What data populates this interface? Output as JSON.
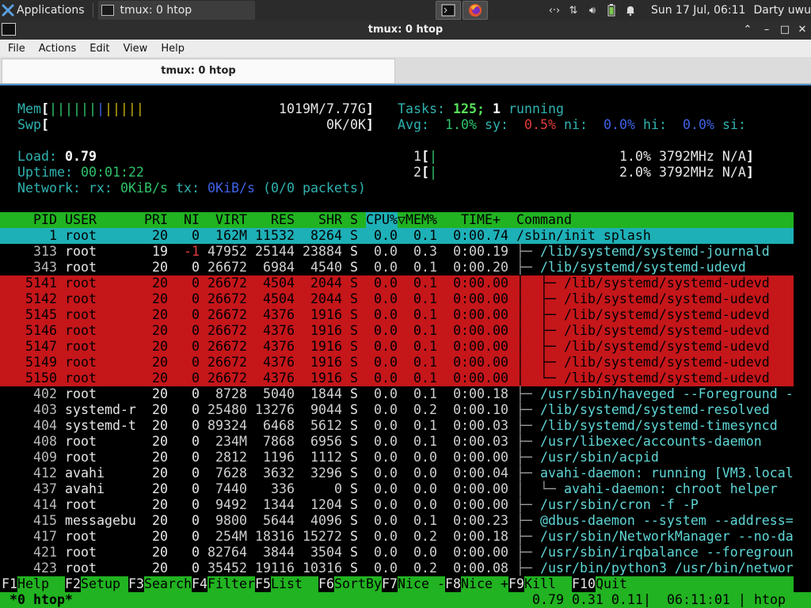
{
  "panel": {
    "apps_label": "Applications",
    "task_label": "tmux: 0 htop",
    "clock": "Sun 17 Jul, 06:11",
    "user": "Darty uwu"
  },
  "window": {
    "title": "tmux: 0 htop",
    "menu": [
      "File",
      "Actions",
      "Edit",
      "View",
      "Help"
    ],
    "tab_label": "tmux: 0 htop"
  },
  "htop": {
    "mem_label": "Mem",
    "mem_bar": "||||||||||||",
    "mem_value": "1019M/7.77G",
    "swp_label": "Swp",
    "swp_value": "0K/0K",
    "tasks_label": "Tasks:",
    "tasks_count": "125;",
    "running_count": "1",
    "running_label": "running",
    "avg_label": "Avg:",
    "avg_us": "1.0%",
    "sy_label": "sy:",
    "avg_sy": "0.5%",
    "ni_label": "ni:",
    "avg_ni": "0.0%",
    "hi_label": "hi:",
    "avg_hi": "0.0%",
    "si_label": "si:",
    "load_label": "Load:",
    "load_value": "0.79",
    "uptime_label": "Uptime:",
    "uptime_value": "00:01:22",
    "network_label": "Network: rx:",
    "rx_value": "0KiB/s",
    "tx_label": "tx:",
    "tx_value": "0KiB/s",
    "packets": "(0/0 packets)",
    "cpu1_label": "1",
    "cpu1_value": "1.0% 3792MHz N/A",
    "cpu2_label": "2",
    "cpu2_value": "2.0% 3792MHz N/A",
    "columns": [
      "PID",
      "USER",
      "PRI",
      "NI",
      "VIRT",
      "RES",
      "SHR",
      "S",
      "CPU%",
      "MEM%",
      "TIME+",
      "Command"
    ],
    "sort_marker": "▽",
    "rows": [
      {
        "pid": "1",
        "user": "root",
        "pri": "20",
        "ni": "0",
        "virt": "162M",
        "res": "11532",
        "shr": "8264",
        "s": "S",
        "cpu": "0.0",
        "mem": "0.1",
        "time": "0:00.74",
        "tree": "",
        "cmd": "/sbin/init splash",
        "style": "selected"
      },
      {
        "pid": "313",
        "user": "root",
        "pri": "19",
        "ni": "-1",
        "virt": "47952",
        "res": "25144",
        "shr": "23884",
        "s": "S",
        "cpu": "0.0",
        "mem": "0.3",
        "time": "0:00.19",
        "tree": "├─ ",
        "cmd": "/lib/systemd/systemd-journald",
        "style": "normal"
      },
      {
        "pid": "343",
        "user": "root",
        "pri": "20",
        "ni": "0",
        "virt": "26672",
        "res": "6984",
        "shr": "4540",
        "s": "S",
        "cpu": "0.0",
        "mem": "0.1",
        "time": "0:00.20",
        "tree": "├─ ",
        "cmd": "/lib/systemd/systemd-udevd",
        "style": "normal"
      },
      {
        "pid": "5141",
        "user": "root",
        "pri": "20",
        "ni": "0",
        "virt": "26672",
        "res": "4504",
        "shr": "2044",
        "s": "S",
        "cpu": "0.0",
        "mem": "0.1",
        "time": "0:00.00",
        "tree": "│  ├─ ",
        "cmd": "/lib/systemd/systemd-udevd",
        "style": "tagged"
      },
      {
        "pid": "5142",
        "user": "root",
        "pri": "20",
        "ni": "0",
        "virt": "26672",
        "res": "4504",
        "shr": "2044",
        "s": "S",
        "cpu": "0.0",
        "mem": "0.1",
        "time": "0:00.00",
        "tree": "│  ├─ ",
        "cmd": "/lib/systemd/systemd-udevd",
        "style": "tagged"
      },
      {
        "pid": "5145",
        "user": "root",
        "pri": "20",
        "ni": "0",
        "virt": "26672",
        "res": "4376",
        "shr": "1916",
        "s": "S",
        "cpu": "0.0",
        "mem": "0.1",
        "time": "0:00.00",
        "tree": "│  ├─ ",
        "cmd": "/lib/systemd/systemd-udevd",
        "style": "tagged"
      },
      {
        "pid": "5146",
        "user": "root",
        "pri": "20",
        "ni": "0",
        "virt": "26672",
        "res": "4376",
        "shr": "1916",
        "s": "S",
        "cpu": "0.0",
        "mem": "0.1",
        "time": "0:00.00",
        "tree": "│  ├─ ",
        "cmd": "/lib/systemd/systemd-udevd",
        "style": "tagged"
      },
      {
        "pid": "5147",
        "user": "root",
        "pri": "20",
        "ni": "0",
        "virt": "26672",
        "res": "4376",
        "shr": "1916",
        "s": "S",
        "cpu": "0.0",
        "mem": "0.1",
        "time": "0:00.00",
        "tree": "│  ├─ ",
        "cmd": "/lib/systemd/systemd-udevd",
        "style": "tagged"
      },
      {
        "pid": "5149",
        "user": "root",
        "pri": "20",
        "ni": "0",
        "virt": "26672",
        "res": "4376",
        "shr": "1916",
        "s": "S",
        "cpu": "0.0",
        "mem": "0.1",
        "time": "0:00.00",
        "tree": "│  ├─ ",
        "cmd": "/lib/systemd/systemd-udevd",
        "style": "tagged"
      },
      {
        "pid": "5150",
        "user": "root",
        "pri": "20",
        "ni": "0",
        "virt": "26672",
        "res": "4376",
        "shr": "1916",
        "s": "S",
        "cpu": "0.0",
        "mem": "0.1",
        "time": "0:00.00",
        "tree": "│  └─ ",
        "cmd": "/lib/systemd/systemd-udevd",
        "style": "tagged"
      },
      {
        "pid": "402",
        "user": "root",
        "pri": "20",
        "ni": "0",
        "virt": "8728",
        "res": "5040",
        "shr": "1844",
        "s": "S",
        "cpu": "0.0",
        "mem": "0.1",
        "time": "0:00.18",
        "tree": "├─ ",
        "cmd": "/usr/sbin/haveged --Foreground -",
        "style": "normal"
      },
      {
        "pid": "403",
        "user": "systemd-r",
        "pri": "20",
        "ni": "0",
        "virt": "25480",
        "res": "13276",
        "shr": "9044",
        "s": "S",
        "cpu": "0.0",
        "mem": "0.2",
        "time": "0:00.10",
        "tree": "├─ ",
        "cmd": "/lib/systemd/systemd-resolved",
        "style": "normal"
      },
      {
        "pid": "404",
        "user": "systemd-t",
        "pri": "20",
        "ni": "0",
        "virt": "89324",
        "res": "6468",
        "shr": "5612",
        "s": "S",
        "cpu": "0.0",
        "mem": "0.1",
        "time": "0:00.03",
        "tree": "├─ ",
        "cmd": "/lib/systemd/systemd-timesyncd",
        "style": "normal"
      },
      {
        "pid": "408",
        "user": "root",
        "pri": "20",
        "ni": "0",
        "virt": "234M",
        "res": "7868",
        "shr": "6956",
        "s": "S",
        "cpu": "0.0",
        "mem": "0.1",
        "time": "0:00.03",
        "tree": "├─ ",
        "cmd": "/usr/libexec/accounts-daemon",
        "style": "normal"
      },
      {
        "pid": "409",
        "user": "root",
        "pri": "20",
        "ni": "0",
        "virt": "2812",
        "res": "1196",
        "shr": "1112",
        "s": "S",
        "cpu": "0.0",
        "mem": "0.0",
        "time": "0:00.00",
        "tree": "├─ ",
        "cmd": "/usr/sbin/acpid",
        "style": "normal"
      },
      {
        "pid": "412",
        "user": "avahi",
        "pri": "20",
        "ni": "0",
        "virt": "7628",
        "res": "3632",
        "shr": "3296",
        "s": "S",
        "cpu": "0.0",
        "mem": "0.0",
        "time": "0:00.04",
        "tree": "├─ ",
        "cmd": "avahi-daemon: running [VM3.local",
        "style": "normal"
      },
      {
        "pid": "437",
        "user": "avahi",
        "pri": "20",
        "ni": "0",
        "virt": "7440",
        "res": "336",
        "shr": "0",
        "s": "S",
        "cpu": "0.0",
        "mem": "0.0",
        "time": "0:00.00",
        "tree": "│  └─ ",
        "cmd": "avahi-daemon: chroot helper",
        "style": "normal"
      },
      {
        "pid": "414",
        "user": "root",
        "pri": "20",
        "ni": "0",
        "virt": "9492",
        "res": "1344",
        "shr": "1204",
        "s": "S",
        "cpu": "0.0",
        "mem": "0.0",
        "time": "0:00.00",
        "tree": "├─ ",
        "cmd": "/usr/sbin/cron -f -P",
        "style": "normal"
      },
      {
        "pid": "415",
        "user": "messagebu",
        "pri": "20",
        "ni": "0",
        "virt": "9800",
        "res": "5644",
        "shr": "4096",
        "s": "S",
        "cpu": "0.0",
        "mem": "0.1",
        "time": "0:00.23",
        "tree": "├─ ",
        "cmd": "@dbus-daemon --system --address=",
        "style": "normal"
      },
      {
        "pid": "417",
        "user": "root",
        "pri": "20",
        "ni": "0",
        "virt": "254M",
        "res": "18316",
        "shr": "15272",
        "s": "S",
        "cpu": "0.0",
        "mem": "0.2",
        "time": "0:00.18",
        "tree": "├─ ",
        "cmd": "/usr/sbin/NetworkManager --no-da",
        "style": "normal"
      },
      {
        "pid": "421",
        "user": "root",
        "pri": "20",
        "ni": "0",
        "virt": "82764",
        "res": "3844",
        "shr": "3504",
        "s": "S",
        "cpu": "0.0",
        "mem": "0.0",
        "time": "0:00.00",
        "tree": "├─ ",
        "cmd": "/usr/sbin/irqbalance --foregroun",
        "style": "normal"
      },
      {
        "pid": "423",
        "user": "root",
        "pri": "20",
        "ni": "0",
        "virt": "35452",
        "res": "19116",
        "shr": "10316",
        "s": "S",
        "cpu": "0.0",
        "mem": "0.2",
        "time": "0:00.08",
        "tree": "├─ ",
        "cmd": "/usr/bin/python3 /usr/bin/networ",
        "style": "normal"
      }
    ],
    "fkeys": [
      {
        "key": "F1",
        "label": "Help  "
      },
      {
        "key": "F2",
        "label": "Setup "
      },
      {
        "key": "F3",
        "label": "Search"
      },
      {
        "key": "F4",
        "label": "Filter"
      },
      {
        "key": "F5",
        "label": "List  "
      },
      {
        "key": "F6",
        "label": "SortBy"
      },
      {
        "key": "F7",
        "label": "Nice -"
      },
      {
        "key": "F8",
        "label": "Nice +"
      },
      {
        "key": "F9",
        "label": "Kill  "
      },
      {
        "key": "F10",
        "label": "Quit"
      }
    ]
  },
  "tmux": {
    "window_label": "*0 htop*",
    "load": "0.79 0.31 0.11",
    "time": "06:11:01",
    "host": "htop"
  },
  "colors": {
    "header_bg": "#21b321",
    "selected_bg": "#1eb0b7",
    "tagged_bg": "#c5161a",
    "panel_bg": "#2b2b2b"
  }
}
